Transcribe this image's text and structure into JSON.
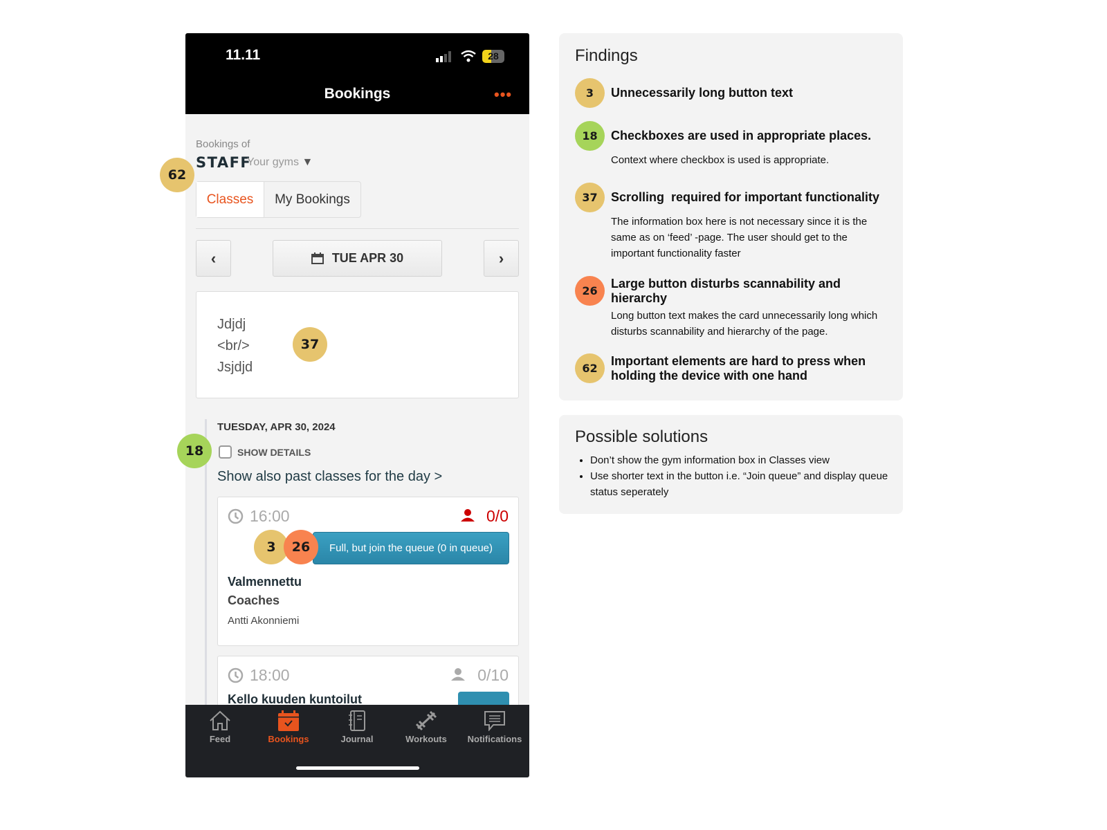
{
  "phone": {
    "status": {
      "time": "11.11",
      "battery": "28"
    },
    "header": {
      "title": "Bookings",
      "more_icon": "ellipsis-icon"
    },
    "bookings_of_label": "Bookings of",
    "gym_name": "STAFF",
    "gym_selector": "Your gyms",
    "tabs": [
      {
        "label": "Classes",
        "active": true
      },
      {
        "label": "My Bookings",
        "active": false
      }
    ],
    "date_nav": {
      "prev": "‹",
      "date": "TUE APR 30",
      "next": "›"
    },
    "info_box": {
      "lines": [
        "Jdjdj",
        "<br/>",
        "Jsjdjd"
      ]
    },
    "day_heading": "TUESDAY, APR 30, 2024",
    "show_details_label": "SHOW DETAILS",
    "show_details_checked": false,
    "past_classes_link": "Show also past classes for the day >",
    "classes": [
      {
        "time": "16:00",
        "capacity": "0/0",
        "full": true,
        "button": "Full, but join the queue (0 in queue)",
        "name": "Valmennettu",
        "category": "Coaches",
        "instructor": "Antti Akonniemi"
      },
      {
        "time": "18:00",
        "capacity": "0/10",
        "full": false,
        "name": "Kello kuuden kuntoilut"
      }
    ],
    "tabbar": [
      {
        "label": "Feed",
        "icon": "home-icon"
      },
      {
        "label": "Bookings",
        "icon": "calendar-icon",
        "active": true
      },
      {
        "label": "Journal",
        "icon": "journal-icon"
      },
      {
        "label": "Workouts",
        "icon": "dumbbell-icon"
      },
      {
        "label": "Notifications",
        "icon": "chat-icon"
      }
    ]
  },
  "annotations": {
    "info_box": "37",
    "gym": "62",
    "checkbox": "18",
    "button_a": "3",
    "button_b": "26"
  },
  "findings": {
    "title": "Findings",
    "items": [
      {
        "num": "3",
        "title": "Unnecessarily long button text",
        "desc": ""
      },
      {
        "num": "18",
        "title": "Checkboxes are used in appropriate places.",
        "desc": "Context where checkbox is used is appropriate."
      },
      {
        "num": "37",
        "title": "Scrolling  required for important functionality",
        "desc": "The information box here is not necessary since it is the same as on ‘feed’ -page. The user should get to the important functionality faster"
      },
      {
        "num": "26",
        "title": "Large button disturbs scannability and hierarchy",
        "desc": "Long button text makes the card unnecessarily long which disturbs scannability and hierarchy of the page."
      },
      {
        "num": "62",
        "title": "Important elements are hard to press when holding the device with one hand",
        "desc": ""
      }
    ]
  },
  "solutions": {
    "title": "Possible solutions",
    "items": [
      "Don’t show the gym information box in Classes view",
      "Use shorter text in the button i.e. “Join queue” and display queue status seperately"
    ]
  },
  "colors": {
    "accent": "#e8541e",
    "yellow": "#e6c46e",
    "green": "#a6d45a",
    "orange": "#f8834f",
    "button_blue": "#2f8fb0",
    "full_red": "#cc0000"
  }
}
